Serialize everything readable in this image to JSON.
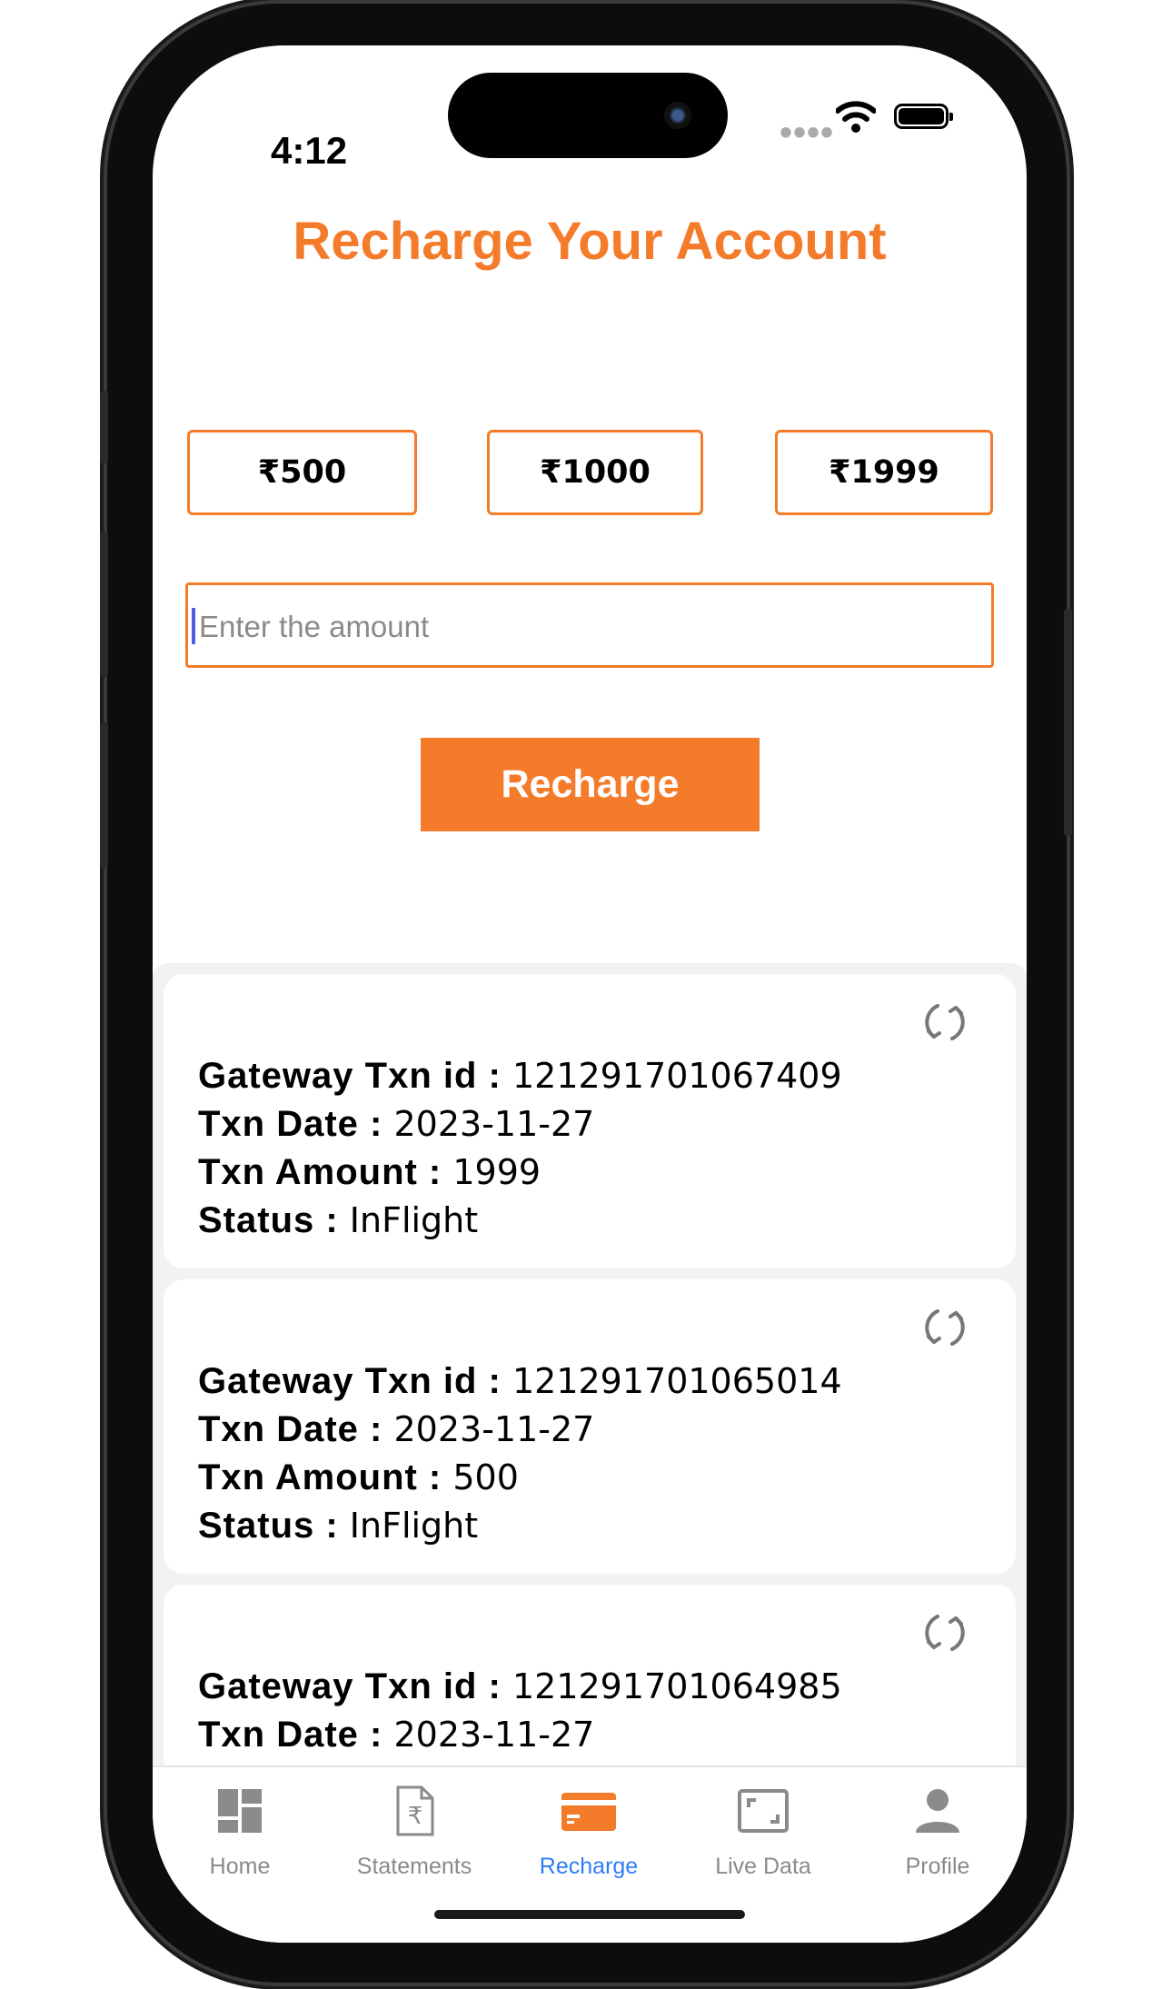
{
  "status_bar": {
    "time": "4:12",
    "signal": "••••"
  },
  "page": {
    "title": "Recharge Your Account"
  },
  "amount_options": [
    "₹500",
    "₹1000",
    "₹1999"
  ],
  "amount_input": {
    "placeholder": "Enter the amount",
    "value": ""
  },
  "recharge_button": {
    "label": "Recharge"
  },
  "labels": {
    "gateway": "Gateway Txn id : ",
    "date": "Txn Date : ",
    "amount": "Txn Amount : ",
    "status": "Status : "
  },
  "transactions": [
    {
      "gateway_txn_id": "121291701067409",
      "txn_date": "2023-11-27",
      "txn_amount": "1999",
      "status": "InFlight"
    },
    {
      "gateway_txn_id": "121291701065014",
      "txn_date": "2023-11-27",
      "txn_amount": "500",
      "status": "InFlight"
    },
    {
      "gateway_txn_id": "121291701064985",
      "txn_date": "2023-11-27",
      "txn_amount": "",
      "status": ""
    }
  ],
  "tabs": [
    {
      "label": "Home",
      "icon": "home-dashboard-icon",
      "active": false
    },
    {
      "label": "Statements",
      "icon": "rupee-document-icon",
      "active": false
    },
    {
      "label": "Recharge",
      "icon": "card-icon",
      "active": true
    },
    {
      "label": "Live Data",
      "icon": "screen-frame-icon",
      "active": false
    },
    {
      "label": "Profile",
      "icon": "person-icon",
      "active": false
    }
  ],
  "colors": {
    "accent": "#f47b2a",
    "active_tab": "#2f7df6",
    "muted": "#8a8a8a"
  }
}
